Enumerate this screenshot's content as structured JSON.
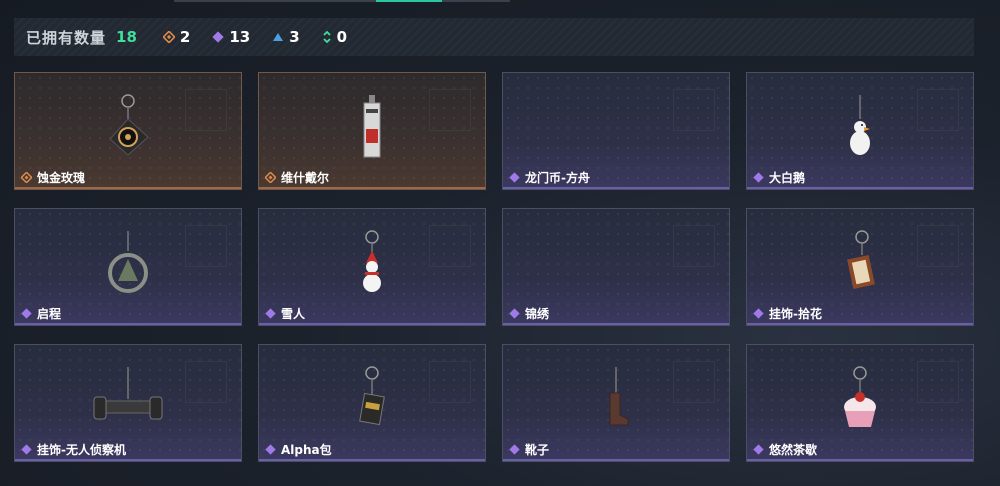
{
  "header": {
    "owned_label": "已拥有数量",
    "owned_total": "18",
    "rarity_counts": [
      {
        "icon": "gold-diamond-icon",
        "color": "#e08a4a",
        "value": "2"
      },
      {
        "icon": "purple-diamond-icon",
        "color": "#a07ae8",
        "value": "13"
      },
      {
        "icon": "blue-triangle-icon",
        "color": "#4aa0e0",
        "value": "3"
      },
      {
        "icon": "green-chevrons-icon",
        "color": "#3ee09a",
        "value": "0"
      }
    ]
  },
  "items": [
    {
      "name": "蚀金玫瑰",
      "rarity": "gold",
      "charm": "rose-compass-charm"
    },
    {
      "name": "维什戴尔",
      "rarity": "gold",
      "charm": "red-tag-charm"
    },
    {
      "name": "龙门币-方舟",
      "rarity": "purple",
      "charm": ""
    },
    {
      "name": "大白鹅",
      "rarity": "purple",
      "charm": "white-goose-charm"
    },
    {
      "name": "启程",
      "rarity": "purple",
      "charm": "ring-charm"
    },
    {
      "name": "雪人",
      "rarity": "purple",
      "charm": "snowman-charm"
    },
    {
      "name": "锦绣",
      "rarity": "purple",
      "charm": ""
    },
    {
      "name": "挂饰-拾花",
      "rarity": "purple",
      "charm": "frame-charm"
    },
    {
      "name": "挂饰-无人侦察机",
      "rarity": "purple",
      "charm": "drone-charm"
    },
    {
      "name": "Alpha包",
      "rarity": "purple",
      "charm": "bag-charm"
    },
    {
      "name": "靴子",
      "rarity": "purple",
      "charm": "boot-charm"
    },
    {
      "name": "悠然茶歇",
      "rarity": "purple",
      "charm": "cupcake-charm"
    }
  ]
}
